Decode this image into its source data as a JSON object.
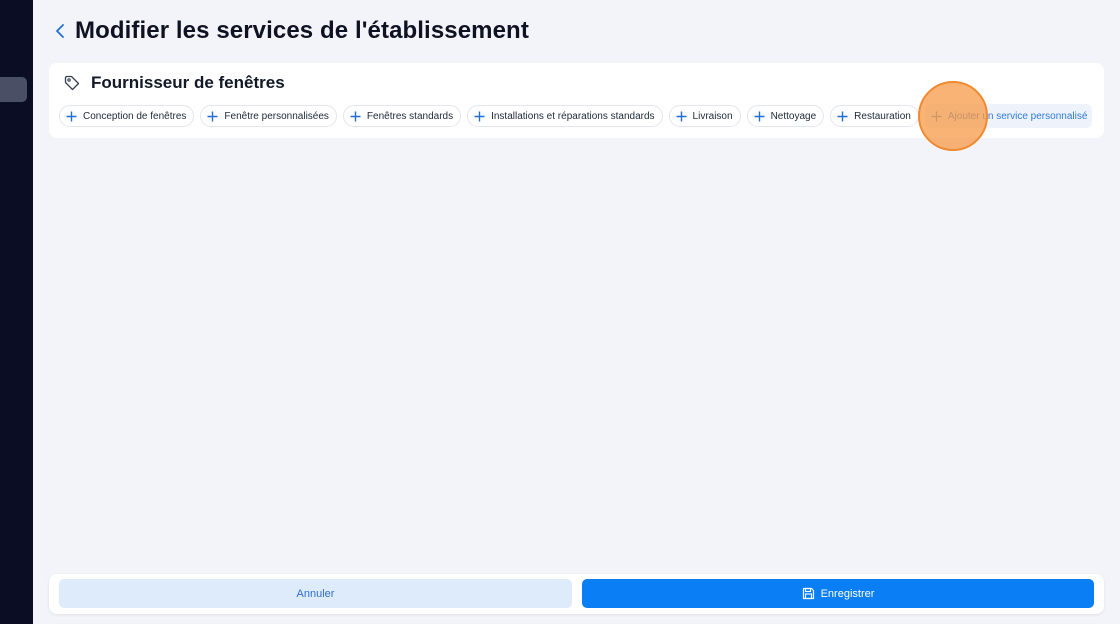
{
  "page": {
    "title": "Modifier les services de l'établissement"
  },
  "category": {
    "title": "Fournisseur de fenêtres",
    "icon": "tag-icon",
    "services": [
      {
        "label": "Conception de fenêtres"
      },
      {
        "label": "Fenêtre personnalisées"
      },
      {
        "label": "Fenêtres standards"
      },
      {
        "label": "Installations et réparations standards"
      },
      {
        "label": "Livraison"
      },
      {
        "label": "Nettoyage"
      },
      {
        "label": "Restauration"
      }
    ],
    "custom_service_label": "Ajouter un service personnalisé"
  },
  "footer": {
    "cancel_label": "Annuler",
    "save_label": "Enregistrer"
  },
  "colors": {
    "primary": "#0a7ef5",
    "accent_light": "#deebfb",
    "sidebar": "#0b0d24",
    "click_indicator": "#f79945"
  }
}
